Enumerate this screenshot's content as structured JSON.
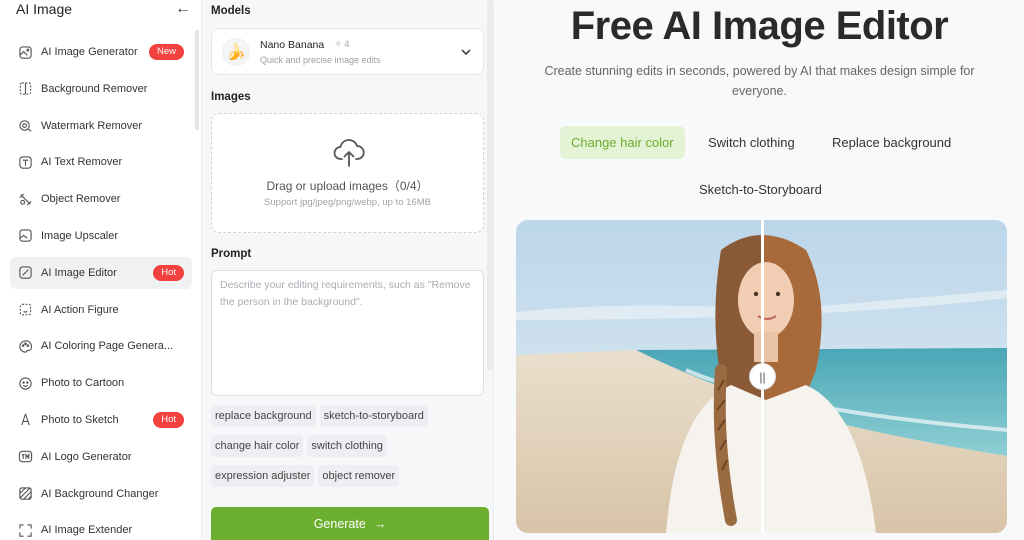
{
  "sidebar": {
    "title": "AI Image",
    "back_icon": "arrow-left-icon",
    "items": [
      {
        "label": "AI Image Generator",
        "icon": "image-generator-icon",
        "badge": "New"
      },
      {
        "label": "Background Remover",
        "icon": "background-remover-icon"
      },
      {
        "label": "Watermark Remover",
        "icon": "watermark-remover-icon"
      },
      {
        "label": "AI Text Remover",
        "icon": "text-remover-icon"
      },
      {
        "label": "Object Remover",
        "icon": "object-remover-icon"
      },
      {
        "label": "Image Upscaler",
        "icon": "image-upscaler-icon"
      },
      {
        "label": "AI Image Editor",
        "icon": "image-editor-icon",
        "badge": "Hot",
        "active": true
      },
      {
        "label": "AI Action Figure",
        "icon": "action-figure-icon"
      },
      {
        "label": "AI Coloring Page Genera...",
        "icon": "palette-icon"
      },
      {
        "label": "Photo to Cartoon",
        "icon": "cartoon-face-icon"
      },
      {
        "label": "Photo to Sketch",
        "icon": "sketch-pen-icon",
        "badge": "Hot"
      },
      {
        "label": "AI Logo Generator",
        "icon": "tm-logo-icon"
      },
      {
        "label": "AI Background Changer",
        "icon": "background-changer-icon"
      },
      {
        "label": "AI Image Extender",
        "icon": "expand-icon"
      }
    ]
  },
  "panel": {
    "models_label": "Models",
    "model": {
      "name": "Nano Banana",
      "credits": "4",
      "description": "Quick and precise image edits",
      "thumb_icon": "banana-icon"
    },
    "images_label": "Images",
    "upload": {
      "text": "Drag or upload images（0/4）",
      "hint": "Support jpg/jpeg/png/webp, up to 16MB",
      "icon": "cloud-upload-icon"
    },
    "prompt_label": "Prompt",
    "prompt_placeholder": "Describe your editing requirements, such as \"Remove the person in the background\".",
    "chips": [
      "replace background",
      "sketch-to-storyboard",
      "change hair color",
      "switch clothing",
      "expression adjuster",
      "object remover"
    ],
    "generate_label": "Generate",
    "generate_icon": "arrow-right-icon"
  },
  "main": {
    "title": "Free AI Image Editor",
    "subtitle": "Create stunning edits in seconds, powered by AI that makes design simple for everyone.",
    "tabs": [
      {
        "label": "Change hair color",
        "active": true
      },
      {
        "label": "Switch clothing"
      },
      {
        "label": "Replace background"
      },
      {
        "label": "Sketch-to-Storyboard"
      }
    ],
    "compare_handle": "||"
  },
  "colors": {
    "accent": "#6cae2d",
    "accent_bg": "#e4f2d6",
    "badge": "#f2413f",
    "panel_bg": "#f6f7f9"
  }
}
